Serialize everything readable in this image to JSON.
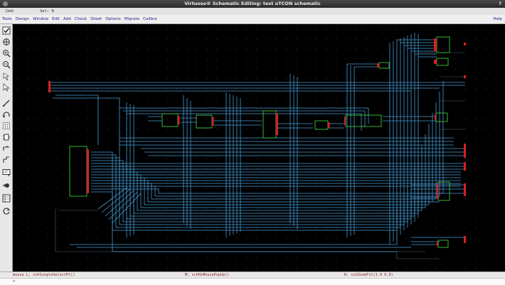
{
  "window": {
    "title": "Virtuoso® Schematic Editing: test uTCON schematic",
    "help_mark": "?"
  },
  "status": {
    "cmd_label": "Cmd:",
    "sel_label": "Sel: 0"
  },
  "menu": {
    "items": [
      "Tools",
      "Design",
      "Window",
      "Edit",
      "Add",
      "Check",
      "Sheet",
      "Options",
      "Migrate",
      "Calibre"
    ],
    "help": "Help"
  },
  "toolbar": {
    "icons": [
      "checkbox-icon",
      "zoom-fit-icon",
      "zoom-in-icon",
      "zoom-out-icon",
      "stretch-icon",
      "select-icon",
      "wire-icon",
      "undo-icon",
      "grid-icon",
      "instance-icon",
      "pin-icon",
      "net-icon",
      "label-icon",
      "property-icon",
      "cellview-icon",
      "refresh-icon"
    ]
  },
  "bottom": {
    "left": "mouse L: schSingleSelectPt()",
    "middle": "M: schHiMousePopUp()",
    "right": "R: schZoomFit(1.0 0.9)"
  },
  "cmdline": {
    "prompt": ">"
  },
  "colors": {
    "wire": "#4aa3e0",
    "instance": "#3cc83c",
    "pin": "#d82020",
    "canvas": "#000000"
  }
}
